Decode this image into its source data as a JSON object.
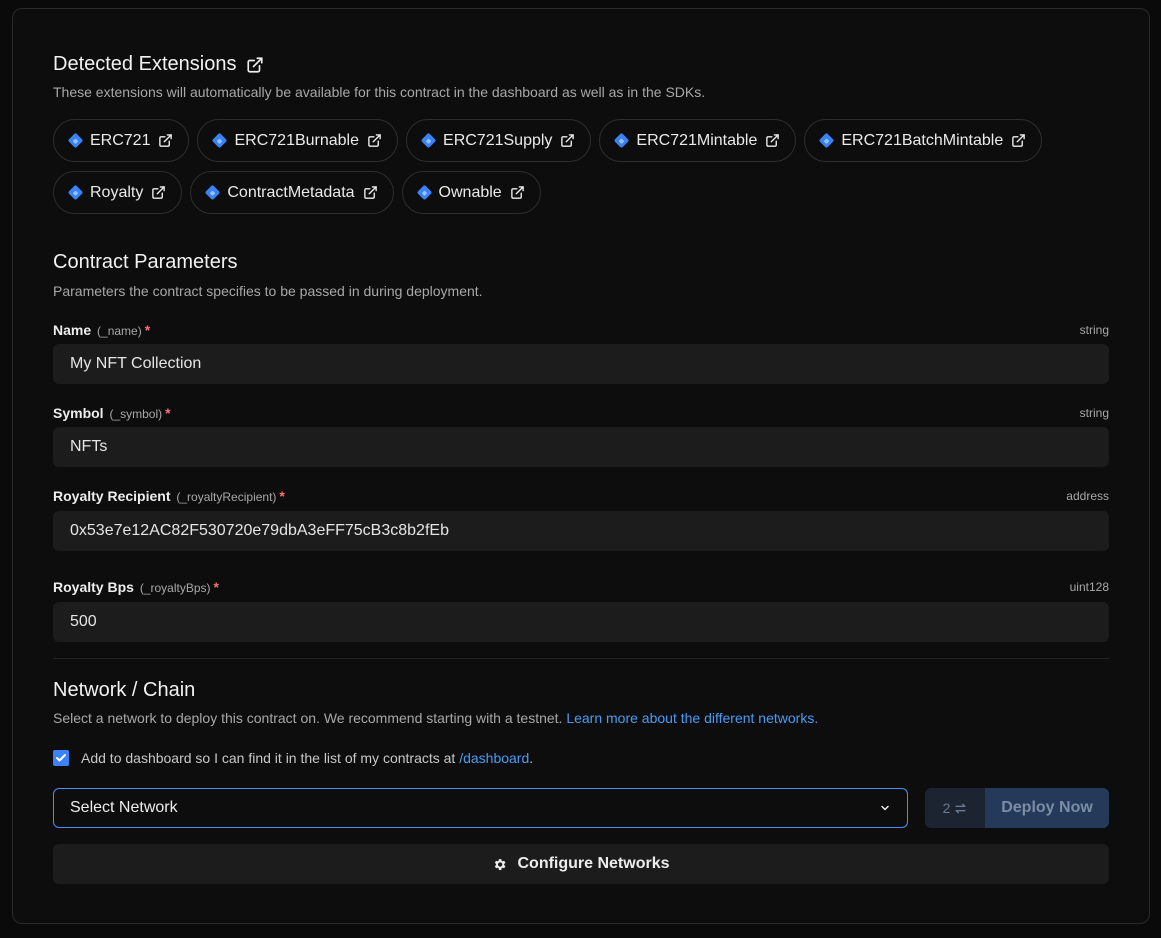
{
  "extensions": {
    "title": "Detected Extensions",
    "description": "These extensions will automatically be available for this contract in the dashboard as well as in the SDKs.",
    "row1": [
      "ERC721",
      "ERC721Burnable",
      "ERC721Supply",
      "ERC721Mintable",
      "ERC721BatchMintable"
    ],
    "row2": [
      "Royalty",
      "ContractMetadata",
      "Ownable"
    ]
  },
  "params": {
    "title": "Contract Parameters",
    "description": "Parameters the contract specifies to be passed in during deployment.",
    "fields": [
      {
        "label": "Name",
        "sub": "(_name)",
        "type": "string",
        "value": "My NFT Collection"
      },
      {
        "label": "Symbol",
        "sub": "(_symbol)",
        "type": "string",
        "value": "NFTs"
      },
      {
        "label": "Royalty Recipient",
        "sub": "(_royaltyRecipient)",
        "type": "address",
        "value": "0x53e7e12AC82F530720e79dbA3eFF75cB3c8b2fEb"
      },
      {
        "label": "Royalty Bps",
        "sub": "(_royaltyBps)",
        "type": "uint128",
        "value": "500"
      }
    ],
    "required_mark": "*"
  },
  "network": {
    "title": "Network / Chain",
    "description": "Select a network to deploy this contract on. We recommend starting with a testnet.",
    "learn_more": "Learn more about the different networks.",
    "checkbox_text": "Add to dashboard so I can find it in the list of my contracts at",
    "checkbox_link": "/dashboard",
    "checkbox_end": ".",
    "select_placeholder": "Select Network",
    "tx_count": "2",
    "deploy_label": "Deploy Now",
    "configure_label": "Configure Networks"
  }
}
